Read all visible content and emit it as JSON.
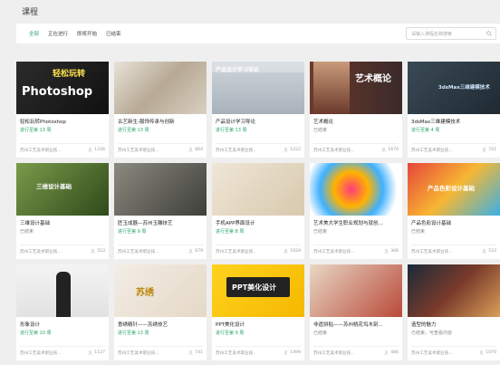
{
  "page_title": "课程",
  "tabs": [
    {
      "label": "全部",
      "active": true
    },
    {
      "label": "正在进行",
      "active": false
    },
    {
      "label": "即将开始",
      "active": false
    },
    {
      "label": "已结束",
      "active": false
    }
  ],
  "search": {
    "placeholder": "请输入课程名称搜索"
  },
  "school": "苏州工艺美术职业技...",
  "courses": [
    {
      "title": "轻松玩转Photoshop",
      "status": "进行至第 13 周",
      "status_color": "green",
      "count": "1336",
      "thumb_text": "Photoshop",
      "thumb_subtext": "轻松玩转",
      "thumb_style": "photoshop"
    },
    {
      "title": "古艺新生-服饰传承与创新",
      "status": "进行至第 13 周",
      "status_color": "green",
      "count": "804",
      "thumb_text": "",
      "thumb_subtext": "",
      "thumb_style": "fabric"
    },
    {
      "title": "产品设计学习导论",
      "status": "进行至第 13 周",
      "status_color": "green",
      "count": "1222",
      "thumb_text": "产品设计学习导论",
      "thumb_subtext": "",
      "thumb_style": "laptop"
    },
    {
      "title": "艺术概论",
      "status": "已结束",
      "status_color": "gray",
      "count": "1670",
      "thumb_text": "艺术概论",
      "thumb_subtext": "",
      "thumb_style": "art"
    },
    {
      "title": "3dsMax三维建模技术",
      "status": "进行至第 4 周",
      "status_color": "green",
      "count": "741",
      "thumb_text": "3dsMax三维建模技术",
      "thumb_subtext": "",
      "thumb_style": "threed"
    },
    {
      "title": "三维设计基础",
      "status": "已结束",
      "status_color": "gray",
      "count": "553",
      "thumb_text": "三维设计基础",
      "thumb_subtext": "",
      "thumb_style": "cubes"
    },
    {
      "title": "匠玉成器—苏州玉雕技艺",
      "status": "进行至第 9 周",
      "status_color": "green",
      "count": "679",
      "thumb_text": "",
      "thumb_subtext": "",
      "thumb_style": "jade"
    },
    {
      "title": "手机APP界面设计",
      "status": "进行至第 8 周",
      "status_color": "green",
      "count": "1629",
      "thumb_text": "",
      "thumb_subtext": "",
      "thumb_style": "sketch"
    },
    {
      "title": "艺术美大学生职业规划与就创...",
      "status": "已结束",
      "status_color": "gray",
      "count": "306",
      "thumb_text": "",
      "thumb_subtext": "",
      "thumb_style": "splash"
    },
    {
      "title": "产品色彩设计基础",
      "status": "已结束",
      "status_color": "gray",
      "count": "533",
      "thumb_text": "产品色彩设计基础",
      "thumb_subtext": "",
      "thumb_style": "color"
    },
    {
      "title": "形象设计",
      "status": "进行至第 10 周",
      "status_color": "green",
      "count": "1127",
      "thumb_text": "",
      "thumb_subtext": "",
      "thumb_style": "person"
    },
    {
      "title": "意绣精针——苏绣技艺",
      "status": "进行至第 13 周",
      "status_color": "green",
      "count": "741",
      "thumb_text": "苏绣",
      "thumb_subtext": "",
      "thumb_style": "embroidery"
    },
    {
      "title": "PPT美化设计",
      "status": "进行至第 9 周",
      "status_color": "green",
      "count": "1499",
      "thumb_text": "PPT美化设计",
      "thumb_subtext": "",
      "thumb_style": "ppt"
    },
    {
      "title": "非遗拼贴——苏州桃花坞木刻...",
      "status": "已结束",
      "status_color": "gray",
      "count": "486",
      "thumb_text": "",
      "thumb_subtext": "",
      "thumb_style": "woodcut"
    },
    {
      "title": "造型的魅力",
      "status": "已结束，可查看内容",
      "status_color": "gray",
      "count": "1070",
      "thumb_text": "",
      "thumb_subtext": "",
      "thumb_style": "shape"
    }
  ],
  "colors": {
    "accent": "#2aa568",
    "gray_text": "#888888",
    "background": "#efefef"
  }
}
